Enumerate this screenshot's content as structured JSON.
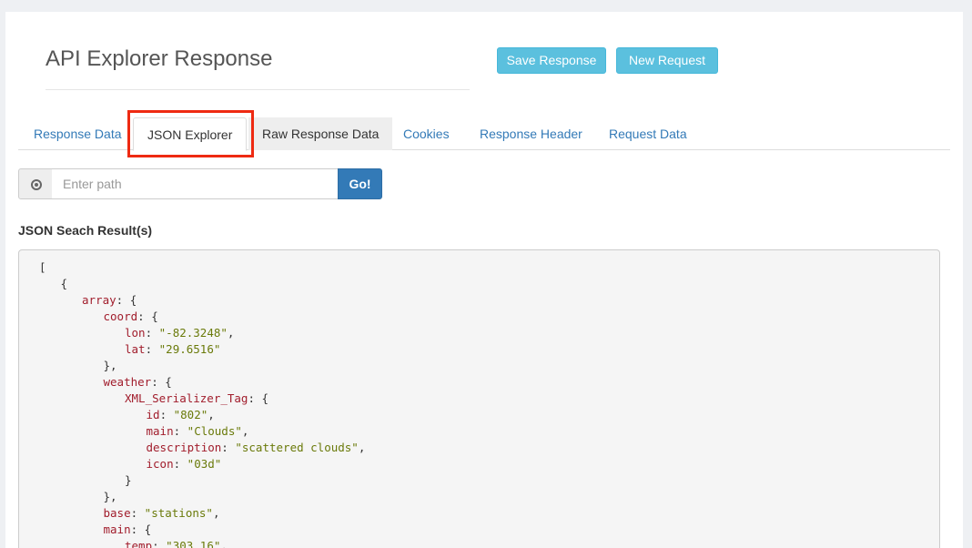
{
  "header": {
    "title": "API Explorer Response",
    "save_label": "Save Response",
    "new_label": "New Request"
  },
  "tabs": [
    {
      "label": "Response Data",
      "active": false
    },
    {
      "label": "JSON Explorer",
      "active": true
    },
    {
      "label": "Raw Response Data",
      "active": false
    },
    {
      "label": "Cookies",
      "active": false
    },
    {
      "label": "Response Header",
      "active": false
    },
    {
      "label": "Request Data",
      "active": false
    }
  ],
  "search": {
    "icon": "target-icon",
    "placeholder": "Enter path",
    "value": "",
    "go_label": "Go!"
  },
  "results": {
    "label": "JSON Seach Result(s)",
    "lines": [
      {
        "indent": 0,
        "key": "",
        "value": "",
        "punct": "["
      },
      {
        "indent": 1,
        "key": "",
        "value": "",
        "punct": "{"
      },
      {
        "indent": 2,
        "key": "array",
        "value": "",
        "punct": ": {"
      },
      {
        "indent": 3,
        "key": "coord",
        "value": "",
        "punct": ": {"
      },
      {
        "indent": 4,
        "key": "lon",
        "value": "\"-82.3248\"",
        "punct": ","
      },
      {
        "indent": 4,
        "key": "lat",
        "value": "\"29.6516\"",
        "punct": ""
      },
      {
        "indent": 3,
        "key": "",
        "value": "",
        "punct": "},"
      },
      {
        "indent": 3,
        "key": "weather",
        "value": "",
        "punct": ": {"
      },
      {
        "indent": 4,
        "key": "XML_Serializer_Tag",
        "value": "",
        "punct": ": {"
      },
      {
        "indent": 5,
        "key": "id",
        "value": "\"802\"",
        "punct": ","
      },
      {
        "indent": 5,
        "key": "main",
        "value": "\"Clouds\"",
        "punct": ","
      },
      {
        "indent": 5,
        "key": "description",
        "value": "\"scattered clouds\"",
        "punct": ","
      },
      {
        "indent": 5,
        "key": "icon",
        "value": "\"03d\"",
        "punct": ""
      },
      {
        "indent": 4,
        "key": "",
        "value": "",
        "punct": "}"
      },
      {
        "indent": 3,
        "key": "",
        "value": "",
        "punct": "},"
      },
      {
        "indent": 3,
        "key": "base",
        "value": "\"stations\"",
        "punct": ","
      },
      {
        "indent": 3,
        "key": "main",
        "value": "",
        "punct": ": {"
      },
      {
        "indent": 4,
        "key": "temp",
        "value": "\"303.16\"",
        "punct": ","
      }
    ]
  },
  "colors": {
    "accent_button": "#5bc0de",
    "primary_button": "#337ab7",
    "highlight_box": "#ee2a12",
    "json_key": "#a11d2c",
    "json_string": "#6a7a0a"
  }
}
